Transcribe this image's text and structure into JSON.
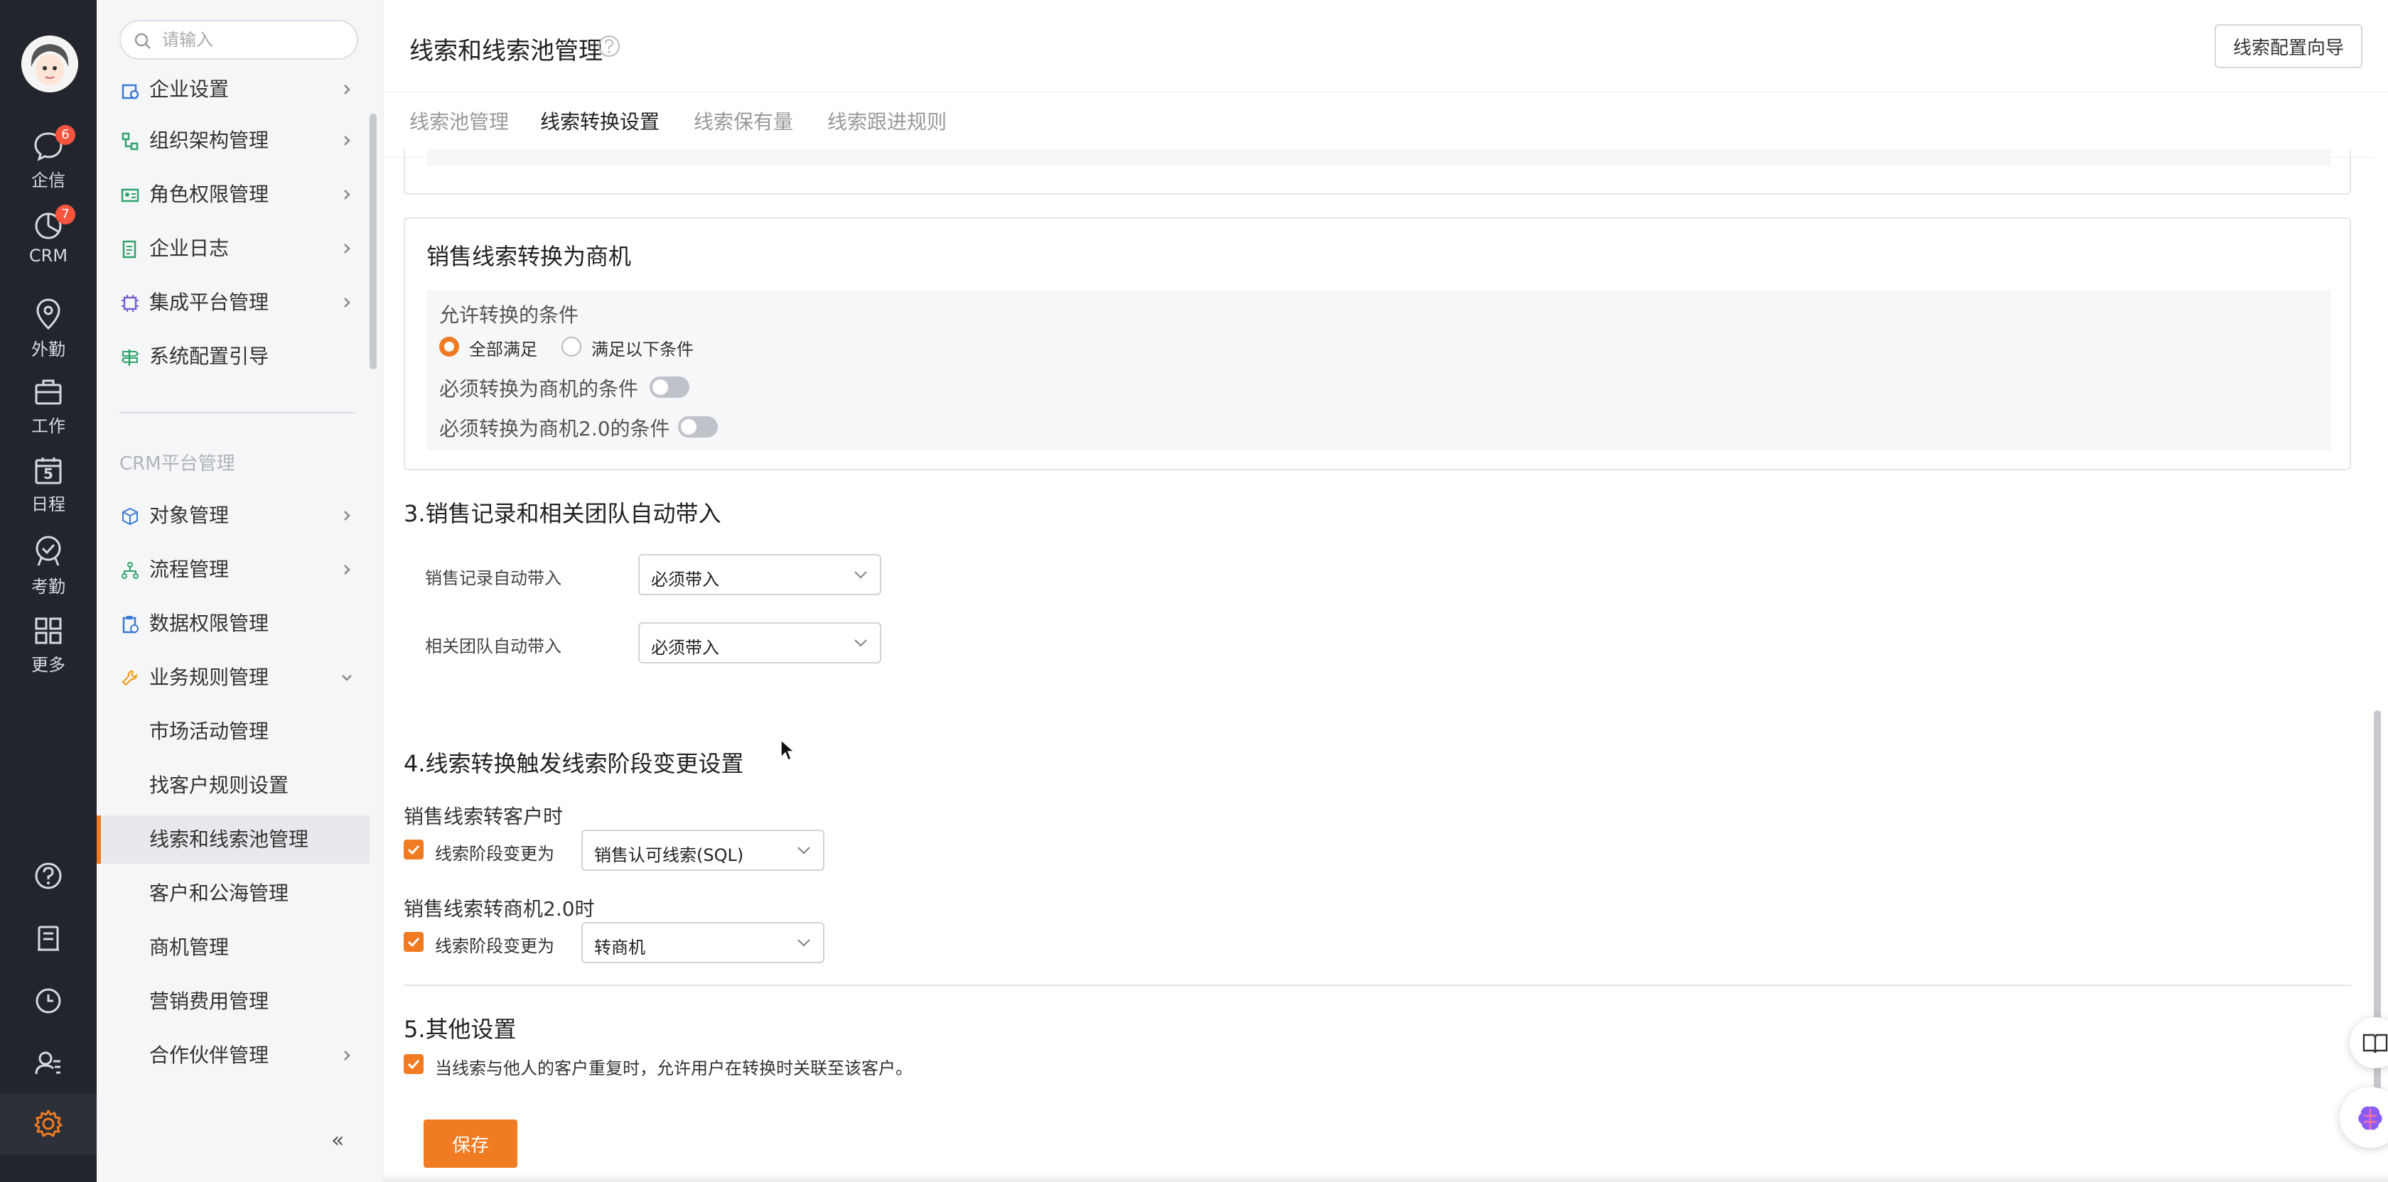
{
  "rail": {
    "items": [
      {
        "label": "企信",
        "icon": "chat-bubble-icon",
        "badge": "6"
      },
      {
        "label": "CRM",
        "icon": "crm-pie-icon",
        "badge": "7"
      },
      {
        "label": "外勤",
        "icon": "location-pin-icon",
        "badge": ""
      },
      {
        "label": "工作",
        "icon": "briefcase-icon",
        "badge": ""
      },
      {
        "label": "日程",
        "icon": "calendar-icon",
        "badge": "",
        "glyph": "5"
      },
      {
        "label": "考勤",
        "icon": "check-badge-icon",
        "badge": ""
      },
      {
        "label": "更多",
        "icon": "grid-icon",
        "badge": ""
      }
    ],
    "bottom_icons": [
      "help-circle-icon",
      "contacts-book-icon",
      "clock-icon",
      "user-manage-icon",
      "settings-gear-icon"
    ]
  },
  "sidebar": {
    "search_placeholder": "请输入",
    "top_items": [
      {
        "label": "企业设置",
        "icon": "building-icon",
        "color": "#3a7bd5",
        "chevron": "right"
      },
      {
        "label": "组织架构管理",
        "icon": "org-tree-icon",
        "color": "#2fa36b",
        "chevron": "right"
      },
      {
        "label": "角色权限管理",
        "icon": "id-card-icon",
        "color": "#2fa36b",
        "chevron": "right"
      },
      {
        "label": "企业日志",
        "icon": "log-doc-icon",
        "color": "#2fa36b",
        "chevron": "right"
      },
      {
        "label": "集成平台管理",
        "icon": "chip-icon",
        "color": "#7b5cd6",
        "chevron": "right"
      },
      {
        "label": "系统配置引导",
        "icon": "signpost-icon",
        "color": "#2fa36b",
        "chevron": ""
      }
    ],
    "section_label": "CRM平台管理",
    "crm_items": [
      {
        "label": "对象管理",
        "icon": "cube-icon",
        "color": "#3a7bd5",
        "chevron": "right"
      },
      {
        "label": "流程管理",
        "icon": "flow-icon",
        "color": "#2fa36b",
        "chevron": "right"
      },
      {
        "label": "数据权限管理",
        "icon": "clipboard-icon",
        "color": "#3a7bd5",
        "chevron": ""
      },
      {
        "label": "业务规则管理",
        "icon": "wrench-icon",
        "color": "#f0a020",
        "chevron": "down"
      }
    ],
    "sub_items": [
      {
        "label": "市场活动管理",
        "active": false,
        "chevron": ""
      },
      {
        "label": "找客户规则设置",
        "active": false,
        "chevron": ""
      },
      {
        "label": "线索和线索池管理",
        "active": true,
        "chevron": ""
      },
      {
        "label": "客户和公海管理",
        "active": false,
        "chevron": ""
      },
      {
        "label": "商机管理",
        "active": false,
        "chevron": ""
      },
      {
        "label": "营销费用管理",
        "active": false,
        "chevron": ""
      },
      {
        "label": "合作伙伴管理",
        "active": false,
        "chevron": "right"
      }
    ],
    "collapse_glyph": "«"
  },
  "header": {
    "title": "线索和线索池管理",
    "wizard_button": "线索配置向导"
  },
  "tabs": [
    {
      "label": "线索池管理",
      "active": false
    },
    {
      "label": "线索转换设置",
      "active": true
    },
    {
      "label": "线索保有量",
      "active": false
    },
    {
      "label": "线索跟进规则",
      "active": false
    }
  ],
  "convert_card": {
    "title": "销售线索转换为商机",
    "condition_label": "允许转换的条件",
    "radios": [
      {
        "label": "全部满足",
        "checked": true
      },
      {
        "label": "满足以下条件",
        "checked": false
      }
    ],
    "toggles": [
      {
        "label": "必须转换为商机的条件",
        "on": false
      },
      {
        "label": "必须转换为商机2.0的条件",
        "on": false
      }
    ]
  },
  "section3": {
    "title": "3.销售记录和相关团队自动带入",
    "fields": [
      {
        "label": "销售记录自动带入",
        "value": "必须带入"
      },
      {
        "label": "相关团队自动带入",
        "value": "必须带入"
      }
    ]
  },
  "section4": {
    "title": "4.线索转换触发线索阶段变更设置",
    "groups": [
      {
        "title": "销售线索转客户时",
        "checkbox_label": "线索阶段变更为",
        "checked": true,
        "value": "销售认可线索(SQL)"
      },
      {
        "title": "销售线索转商机2.0时",
        "checkbox_label": "线索阶段变更为",
        "checked": true,
        "value": "转商机"
      }
    ]
  },
  "section5": {
    "title": "5.其他设置",
    "checkbox_label": "当线索与他人的客户重复时，允许用户在转换时关联至该客户。",
    "checked": true
  },
  "save_button": "保存",
  "colors": {
    "accent": "#f07b22",
    "rail_bg": "#22262c",
    "sidebar_bg": "#f5f6f8",
    "badge": "#f5543f"
  }
}
